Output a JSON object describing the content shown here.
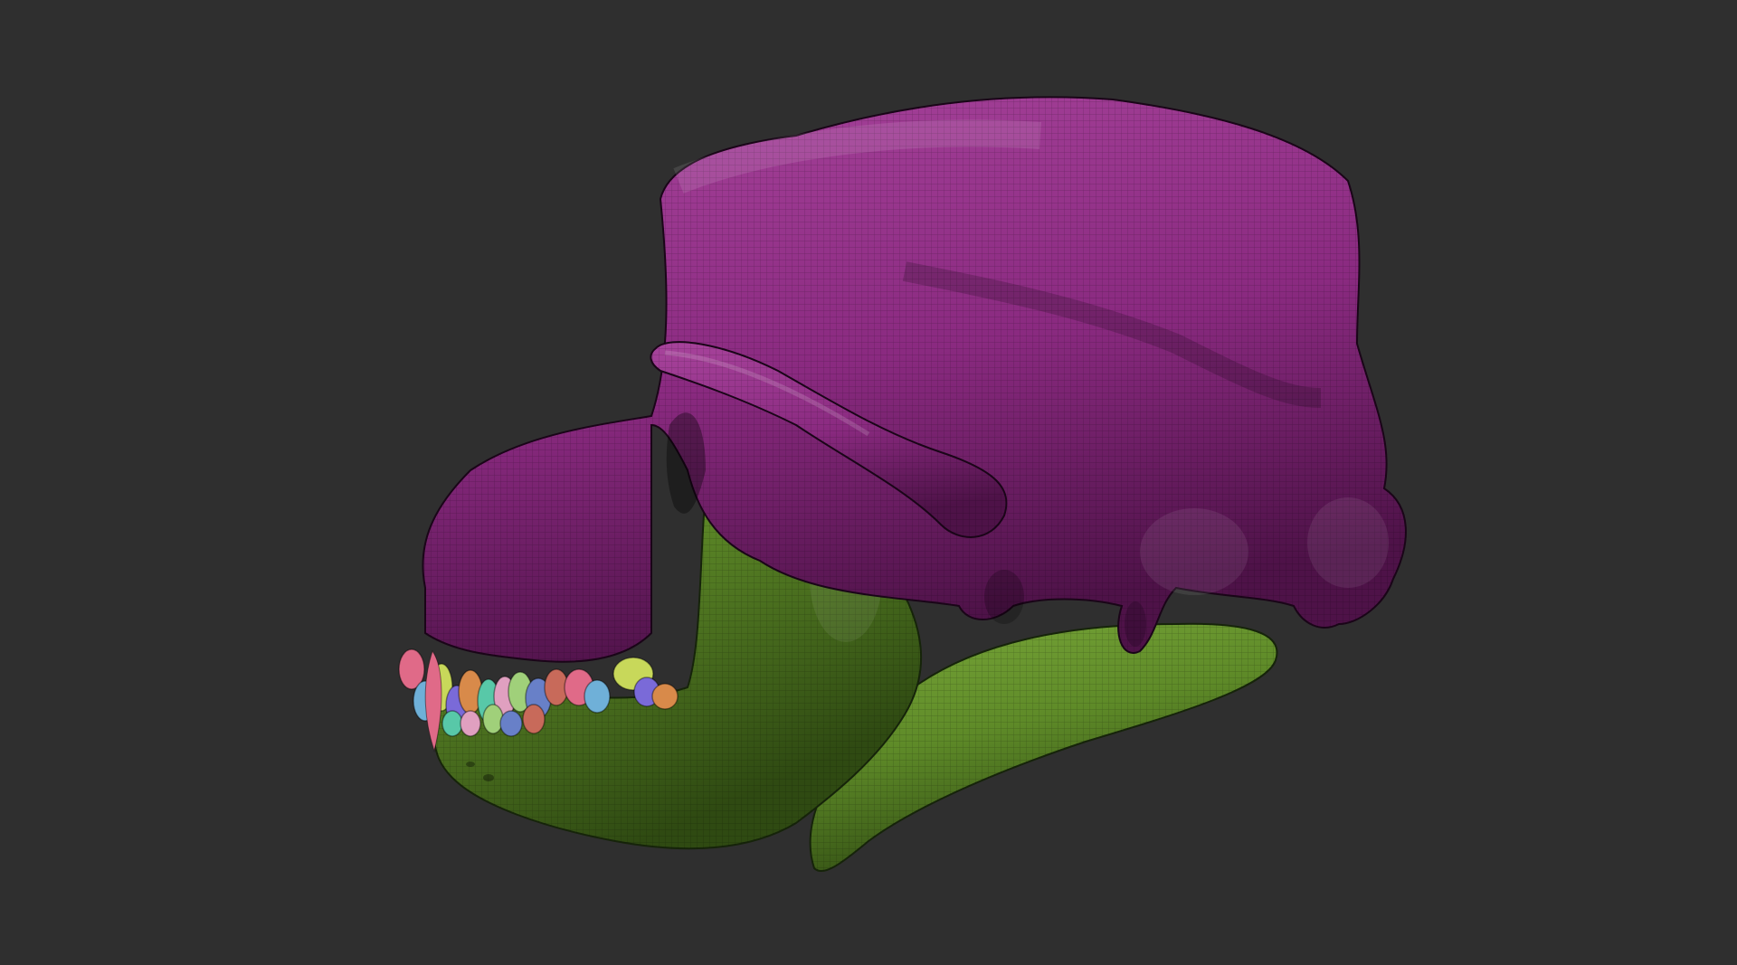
{
  "viewport": {
    "background": "#2f2f2f"
  },
  "model": {
    "subject": "skull",
    "polygroup_colors": {
      "cranium": "#8a2a80",
      "cranium_highlight": "#a8449c",
      "cranium_shadow": "#4e1248",
      "mandible": "#5e8a28",
      "mandible_highlight": "#7aa83a",
      "mandible_shadow": "#2f4a12",
      "teeth": [
        "#e06a88",
        "#6fb0d8",
        "#c8d85a",
        "#7a6ad8",
        "#d88a4a",
        "#58c8a8",
        "#e0a0c0",
        "#a0d07a",
        "#6880c8",
        "#c86a5a"
      ]
    },
    "wireframe_visible": true
  }
}
